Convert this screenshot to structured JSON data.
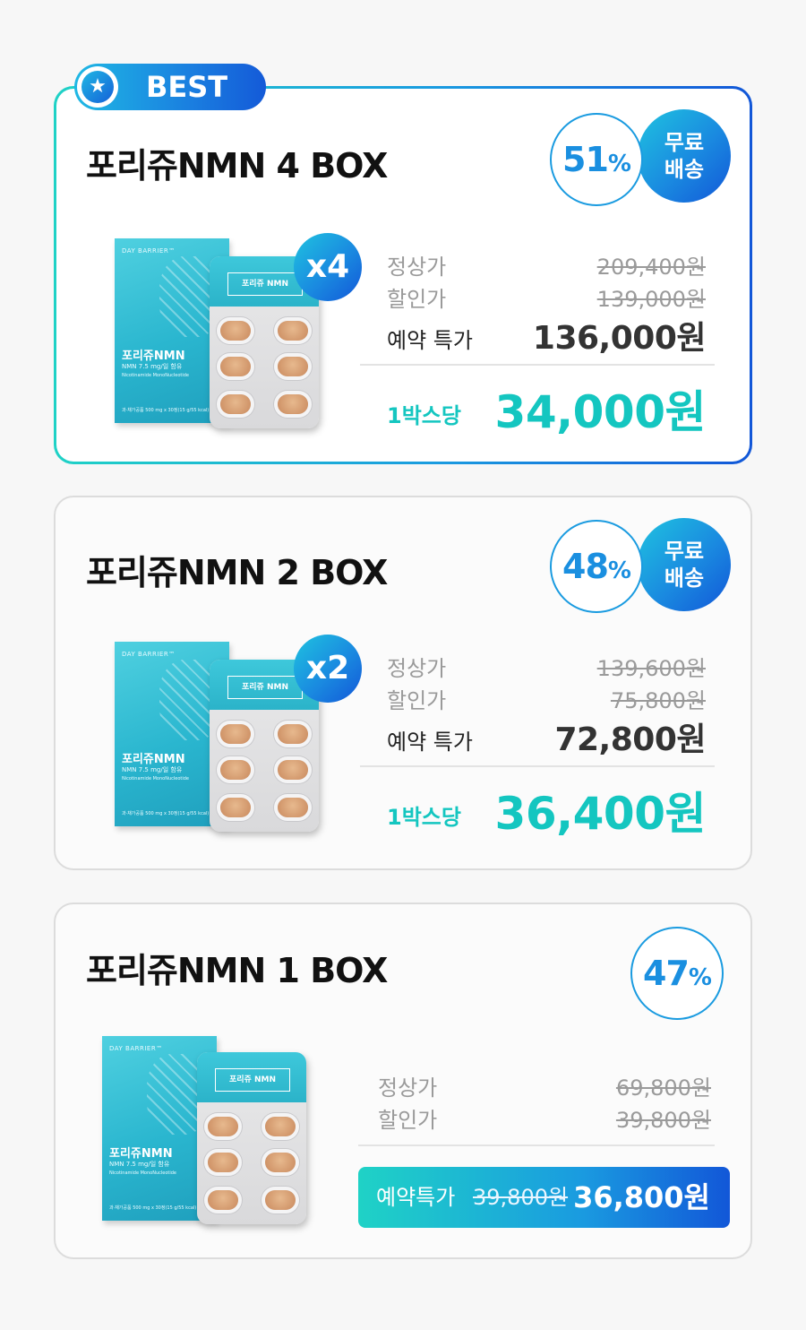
{
  "best_badge": {
    "label": "BEST",
    "icon": "star-icon"
  },
  "colors": {
    "accent_teal": "#14c6c0",
    "accent_blue": "#1a8fe0",
    "deep_blue": "#1257d8"
  },
  "product_image": {
    "brand": "DAY BARRIER™",
    "name": "포리쥬NMN",
    "content": "NMN 7.5 mg/일 함유",
    "ingredient": "Nicotinamide MonoNucleotide",
    "type": "과·채가공품",
    "spec": "500 mg x 30정(15 g/55 kcal)",
    "blister_label": "포리쥬 NMN"
  },
  "cards": [
    {
      "title": "포리쥬NMN 4 BOX",
      "discount_number": "51",
      "discount_symbol": "%",
      "free_shipping": [
        "무료",
        "배송"
      ],
      "multiplier": "x4",
      "regular_label": "정상가",
      "regular_price": "209,400원",
      "sale_label": "할인가",
      "sale_price": "139,000원",
      "reserve_label": "예약 특가",
      "reserve_price": "136,000원",
      "per_box_label": "1박스당",
      "per_box_price": "34,000원"
    },
    {
      "title": "포리쥬NMN 2 BOX",
      "discount_number": "48",
      "discount_symbol": "%",
      "free_shipping": [
        "무료",
        "배송"
      ],
      "multiplier": "x2",
      "regular_label": "정상가",
      "regular_price": "139,600원",
      "sale_label": "할인가",
      "sale_price": "75,800원",
      "reserve_label": "예약 특가",
      "reserve_price": "72,800원",
      "per_box_label": "1박스당",
      "per_box_price": "36,400원"
    },
    {
      "title": "포리쥬NMN 1 BOX",
      "discount_number": "47",
      "discount_symbol": "%",
      "regular_label": "정상가",
      "regular_price": "69,800원",
      "sale_label": "할인가",
      "sale_price": "39,800원",
      "reserve_label": "예약특가",
      "reserve_old_price": "39,800원",
      "reserve_price": "36,800원"
    }
  ]
}
